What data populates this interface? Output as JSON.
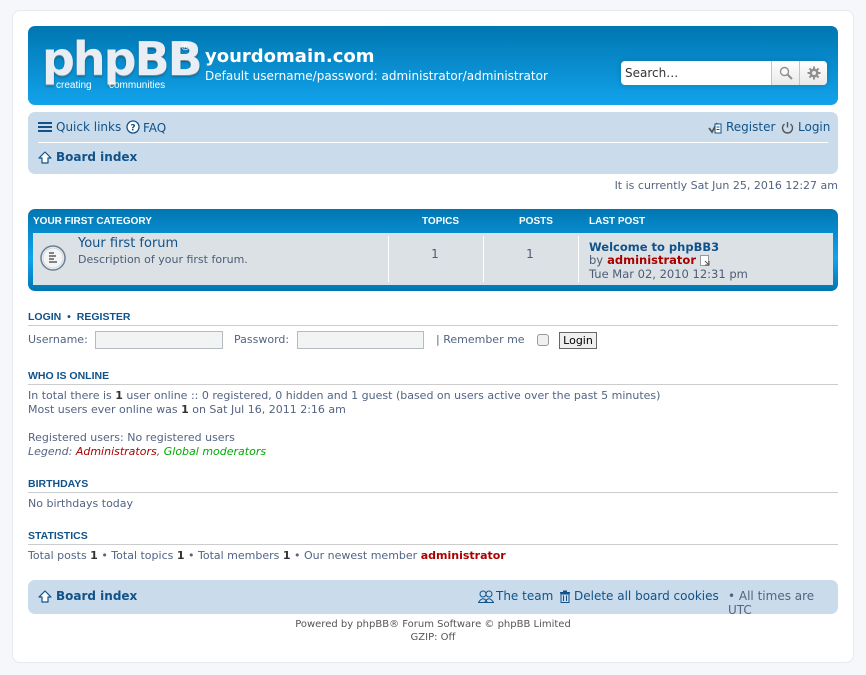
{
  "header": {
    "logo_text": "phpBB",
    "logo_registered": "®",
    "logo_tagline_1": "creating",
    "logo_tagline_2": "communities",
    "site_title": "yourdomain.com",
    "site_description": "Default username/password: administrator/administrator",
    "search_placeholder": "Search…",
    "search_icon": "magnifier-icon",
    "advanced_search_icon": "gear-icon"
  },
  "navbar": {
    "quick_links": "Quick links",
    "faq": "FAQ",
    "register": "Register",
    "login": "Login",
    "breadcrumb": "Board index"
  },
  "current_time": "It is currently Sat Jun 25, 2016 12:27 am",
  "category": {
    "title": "YOUR FIRST CATEGORY",
    "col_topics": "TOPICS",
    "col_posts": "POSTS",
    "col_last_post": "LAST POST",
    "forums": [
      {
        "name": "Your first forum",
        "description": "Description of your first forum.",
        "topics": "1",
        "posts": "1",
        "last_post_title": "Welcome to phpBB3",
        "last_post_by": "by",
        "last_post_author": "administrator",
        "last_post_time": "Tue Mar 02, 2010 12:31 pm"
      }
    ]
  },
  "login_section": {
    "heading_login": "LOGIN",
    "heading_sep": "•",
    "heading_register": "REGISTER",
    "username_label": "Username:",
    "username_value": "",
    "password_label": "Password:",
    "password_value": "",
    "remember_label": "| Remember me",
    "remember_checked": false,
    "login_button": "Login"
  },
  "who_is_online": {
    "heading": "WHO IS ONLINE",
    "line1_a": "In total there is ",
    "line1_count": "1",
    "line1_b": " user online :: 0 registered, 0 hidden and 1 guest (based on users active over the past 5 minutes)",
    "line2_a": "Most users ever online was ",
    "line2_count": "1",
    "line2_b": " on Sat Jul 16, 2011 2:16 am",
    "registered_users": "Registered users: No registered users",
    "legend_label": "Legend: ",
    "legend_admins": "Administrators",
    "legend_sep": ", ",
    "legend_mods": "Global moderators",
    "admin_color": "#AA0000",
    "mod_color": "#00AA00"
  },
  "birthdays": {
    "heading": "BIRTHDAYS",
    "text": "No birthdays today"
  },
  "statistics": {
    "heading": "STATISTICS",
    "posts_label": "Total posts ",
    "posts": "1",
    "topics_label": " • Total topics ",
    "topics": "1",
    "members_label": " • Total members ",
    "members": "1",
    "newest_label": " • Our newest member ",
    "newest_member": "administrator"
  },
  "footer_nav": {
    "breadcrumb": "Board index",
    "team": "The team",
    "delete_cookies": "Delete all board cookies",
    "timezone": "• All times are UTC"
  },
  "copyright": {
    "line1": "Powered by phpBB® Forum Software © phpBB Limited",
    "line2": "GZIP: Off"
  },
  "colors": {
    "header_gradient_top": "#0076B1",
    "header_gradient_bottom": "#12A3EB",
    "navbar_bg": "#CADCEB",
    "link": "#105289",
    "text": "#536482",
    "admin_red": "#AA0000"
  }
}
